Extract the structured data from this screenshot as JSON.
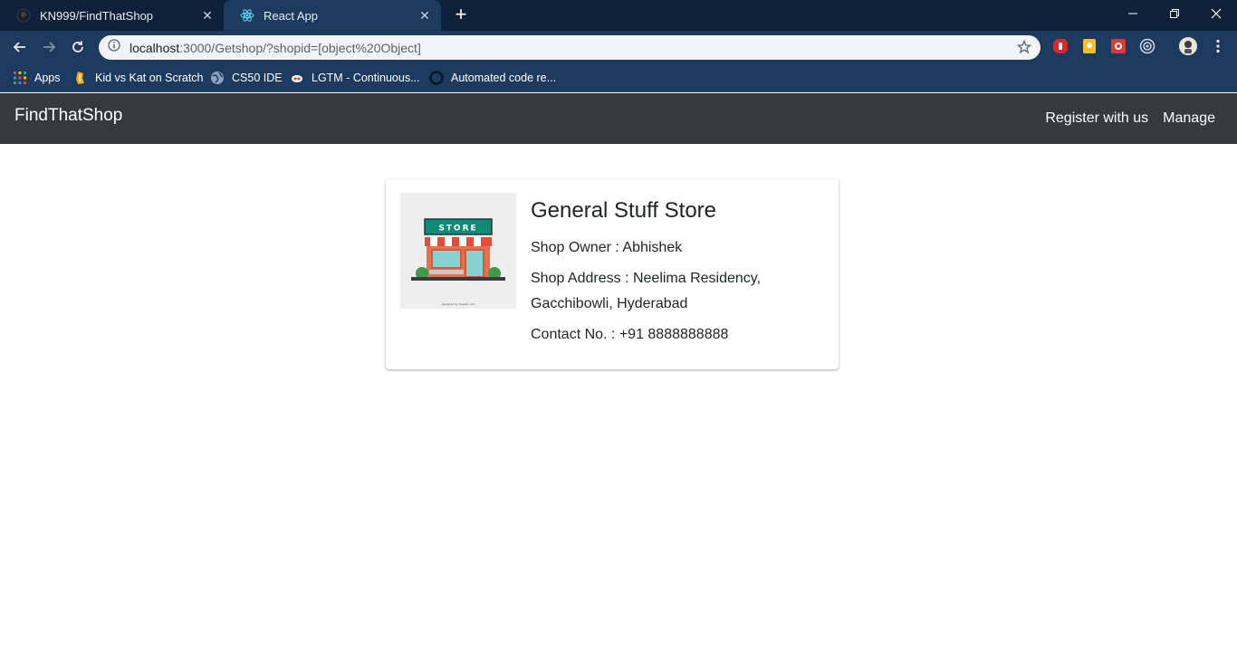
{
  "browser": {
    "tabs": [
      {
        "title": "KN999/FindThatShop",
        "icon": "github-icon",
        "active": false
      },
      {
        "title": "React App",
        "icon": "react-icon",
        "active": true
      }
    ],
    "address": {
      "host": "localhost",
      "rest": ":3000/Getshop/?shopid=[object%20Object]"
    },
    "bookmarks": [
      {
        "label": "Apps",
        "icon": "apps-grid-icon"
      },
      {
        "label": "Kid vs Kat on Scratch",
        "icon": "scratch-icon"
      },
      {
        "label": "CS50 IDE",
        "icon": "globe-icon"
      },
      {
        "label": "LGTM - Continuous...",
        "icon": "lgtm-icon"
      },
      {
        "label": "Automated code re...",
        "icon": "codacy-icon"
      }
    ]
  },
  "navbar": {
    "brand": "FindThatShop",
    "links": [
      "Register with us",
      "Manage"
    ]
  },
  "shop": {
    "name": "General Stuff Store",
    "owner": "Shop Owner : Abhishek",
    "address": "Shop Address : Neelima Residency, Gacchibowli, Hyderabad",
    "contact": "Contact No. : +91 8888888888",
    "image_sign": "STORE",
    "image_credit": "designed by freepik.com"
  },
  "colors": {
    "navbar_bg": "#343a40",
    "chrome_dark": "#0f2139",
    "chrome_toolbar": "#1d3a5f"
  }
}
